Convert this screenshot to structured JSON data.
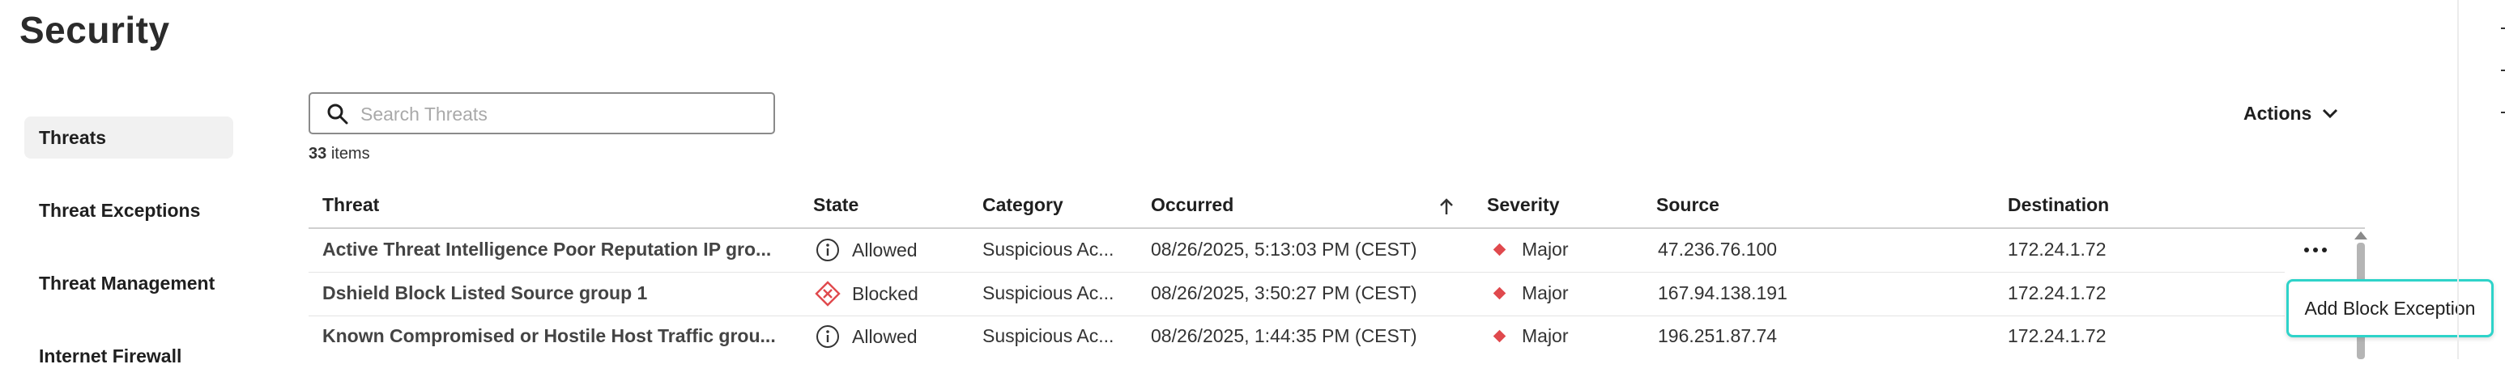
{
  "page": {
    "title": "Security"
  },
  "sidebar": {
    "items": [
      {
        "label": "Threats",
        "active": true
      },
      {
        "label": "Threat Exceptions",
        "active": false
      },
      {
        "label": "Threat Management",
        "active": false
      },
      {
        "label": "Internet Firewall",
        "active": false
      }
    ]
  },
  "search": {
    "placeholder": "Search Threats",
    "value": ""
  },
  "items_count": {
    "count": "33",
    "suffix": "items"
  },
  "actions": {
    "label": "Actions"
  },
  "table": {
    "columns": [
      "Threat",
      "State",
      "Category",
      "Occurred",
      "Severity",
      "Source",
      "Destination"
    ],
    "sorted_column": "Occurred",
    "sort_direction": "ascending",
    "rows": [
      {
        "threat": "Active Threat Intelligence Poor Reputation IP gro...",
        "state": "Allowed",
        "state_icon": "info-circle-icon",
        "category": "Suspicious Ac...",
        "occurred": "08/26/2025, 5:13:03 PM (CEST)",
        "severity": "Major",
        "source": "47.236.76.100",
        "destination": "172.24.1.72"
      },
      {
        "threat": "Dshield Block Listed Source group 1",
        "state": "Blocked",
        "state_icon": "blocked-diamond-icon",
        "category": "Suspicious Ac...",
        "occurred": "08/26/2025, 3:50:27 PM (CEST)",
        "severity": "Major",
        "source": "167.94.138.191",
        "destination": "172.24.1.72"
      },
      {
        "threat": "Known Compromised or Hostile Host Traffic grou...",
        "state": "Allowed",
        "state_icon": "info-circle-icon",
        "category": "Suspicious Ac...",
        "occurred": "08/26/2025, 1:44:35 PM (CEST)",
        "severity": "Major",
        "source": "196.251.87.74",
        "destination": "172.24.1.72"
      }
    ]
  },
  "row_menu": {
    "item_label": "Add Block Exception"
  },
  "colors": {
    "severity_major": "#e0494d",
    "blocked": "#e0494d",
    "focus_ring": "#2ed3c9"
  }
}
